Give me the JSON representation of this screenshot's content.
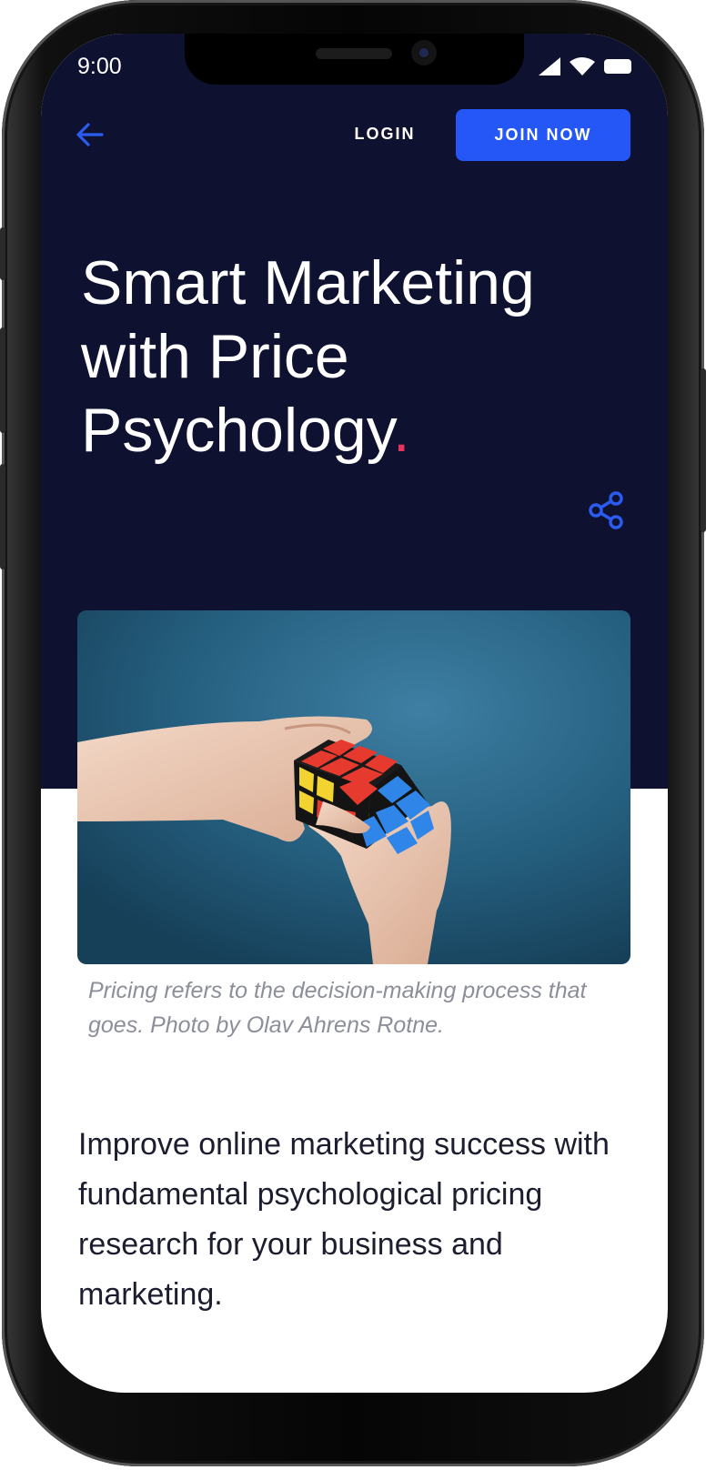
{
  "status_bar": {
    "time": "9:00",
    "icons": [
      "signal-icon",
      "wifi-icon",
      "battery-icon"
    ]
  },
  "nav": {
    "back_icon": "arrow-left-icon",
    "login_label": "LOGIN",
    "join_label": "JOIN NOW"
  },
  "article": {
    "title": "Smart Marketing with Price Psychology",
    "title_punctuation": ".",
    "share_icon": "share-icon",
    "image_alt": "Hands solving a Rubik's cube",
    "caption": "Pricing refers to the decision-making process that goes. Photo by Olav Ahrens Rotne.",
    "lead": "Improve online marketing success with fundamental psychological pricing research for your business and marketing."
  },
  "colors": {
    "hero_background": "#0f1130",
    "accent_blue": "#2457f5",
    "title_dot": "#e8335f",
    "caption_text": "#8c8f99",
    "body_text": "#1c1d2f"
  }
}
